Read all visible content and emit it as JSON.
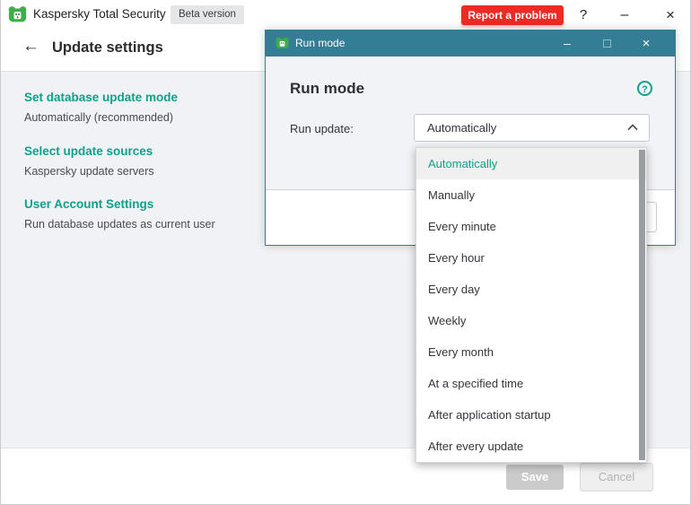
{
  "window": {
    "app_title": "Kaspersky Total Security",
    "beta_badge": "Beta version",
    "report_button": "Report a problem",
    "help_glyph": "?",
    "minimize_glyph": "–",
    "close_glyph": "×"
  },
  "page": {
    "back_glyph": "←",
    "title": "Update settings",
    "sections": [
      {
        "title": "Set database update mode",
        "subtitle": "Automatically (recommended)"
      },
      {
        "title": "Select update sources",
        "subtitle": "Kaspersky update servers"
      },
      {
        "title": "User Account Settings",
        "subtitle": "Run database updates as current user"
      }
    ],
    "save_label": "Save",
    "cancel_label": "Cancel"
  },
  "dialog": {
    "titlebar_title": "Run mode",
    "minimize_glyph": "–",
    "close_glyph": "×",
    "heading": "Run mode",
    "help_glyph": "?",
    "field_label": "Run update:",
    "field_value": "Automatically",
    "selected_index": 0,
    "options": [
      "Automatically",
      "Manually",
      "Every minute",
      "Every hour",
      "Every day",
      "Weekly",
      "Every month",
      "At a specified time",
      "After application startup",
      "After every update"
    ]
  },
  "colors": {
    "accent_teal": "#337e95",
    "brand_green": "#0ea18c",
    "alert_red": "#ee2a24",
    "panel_gray": "#f0f2f5"
  }
}
